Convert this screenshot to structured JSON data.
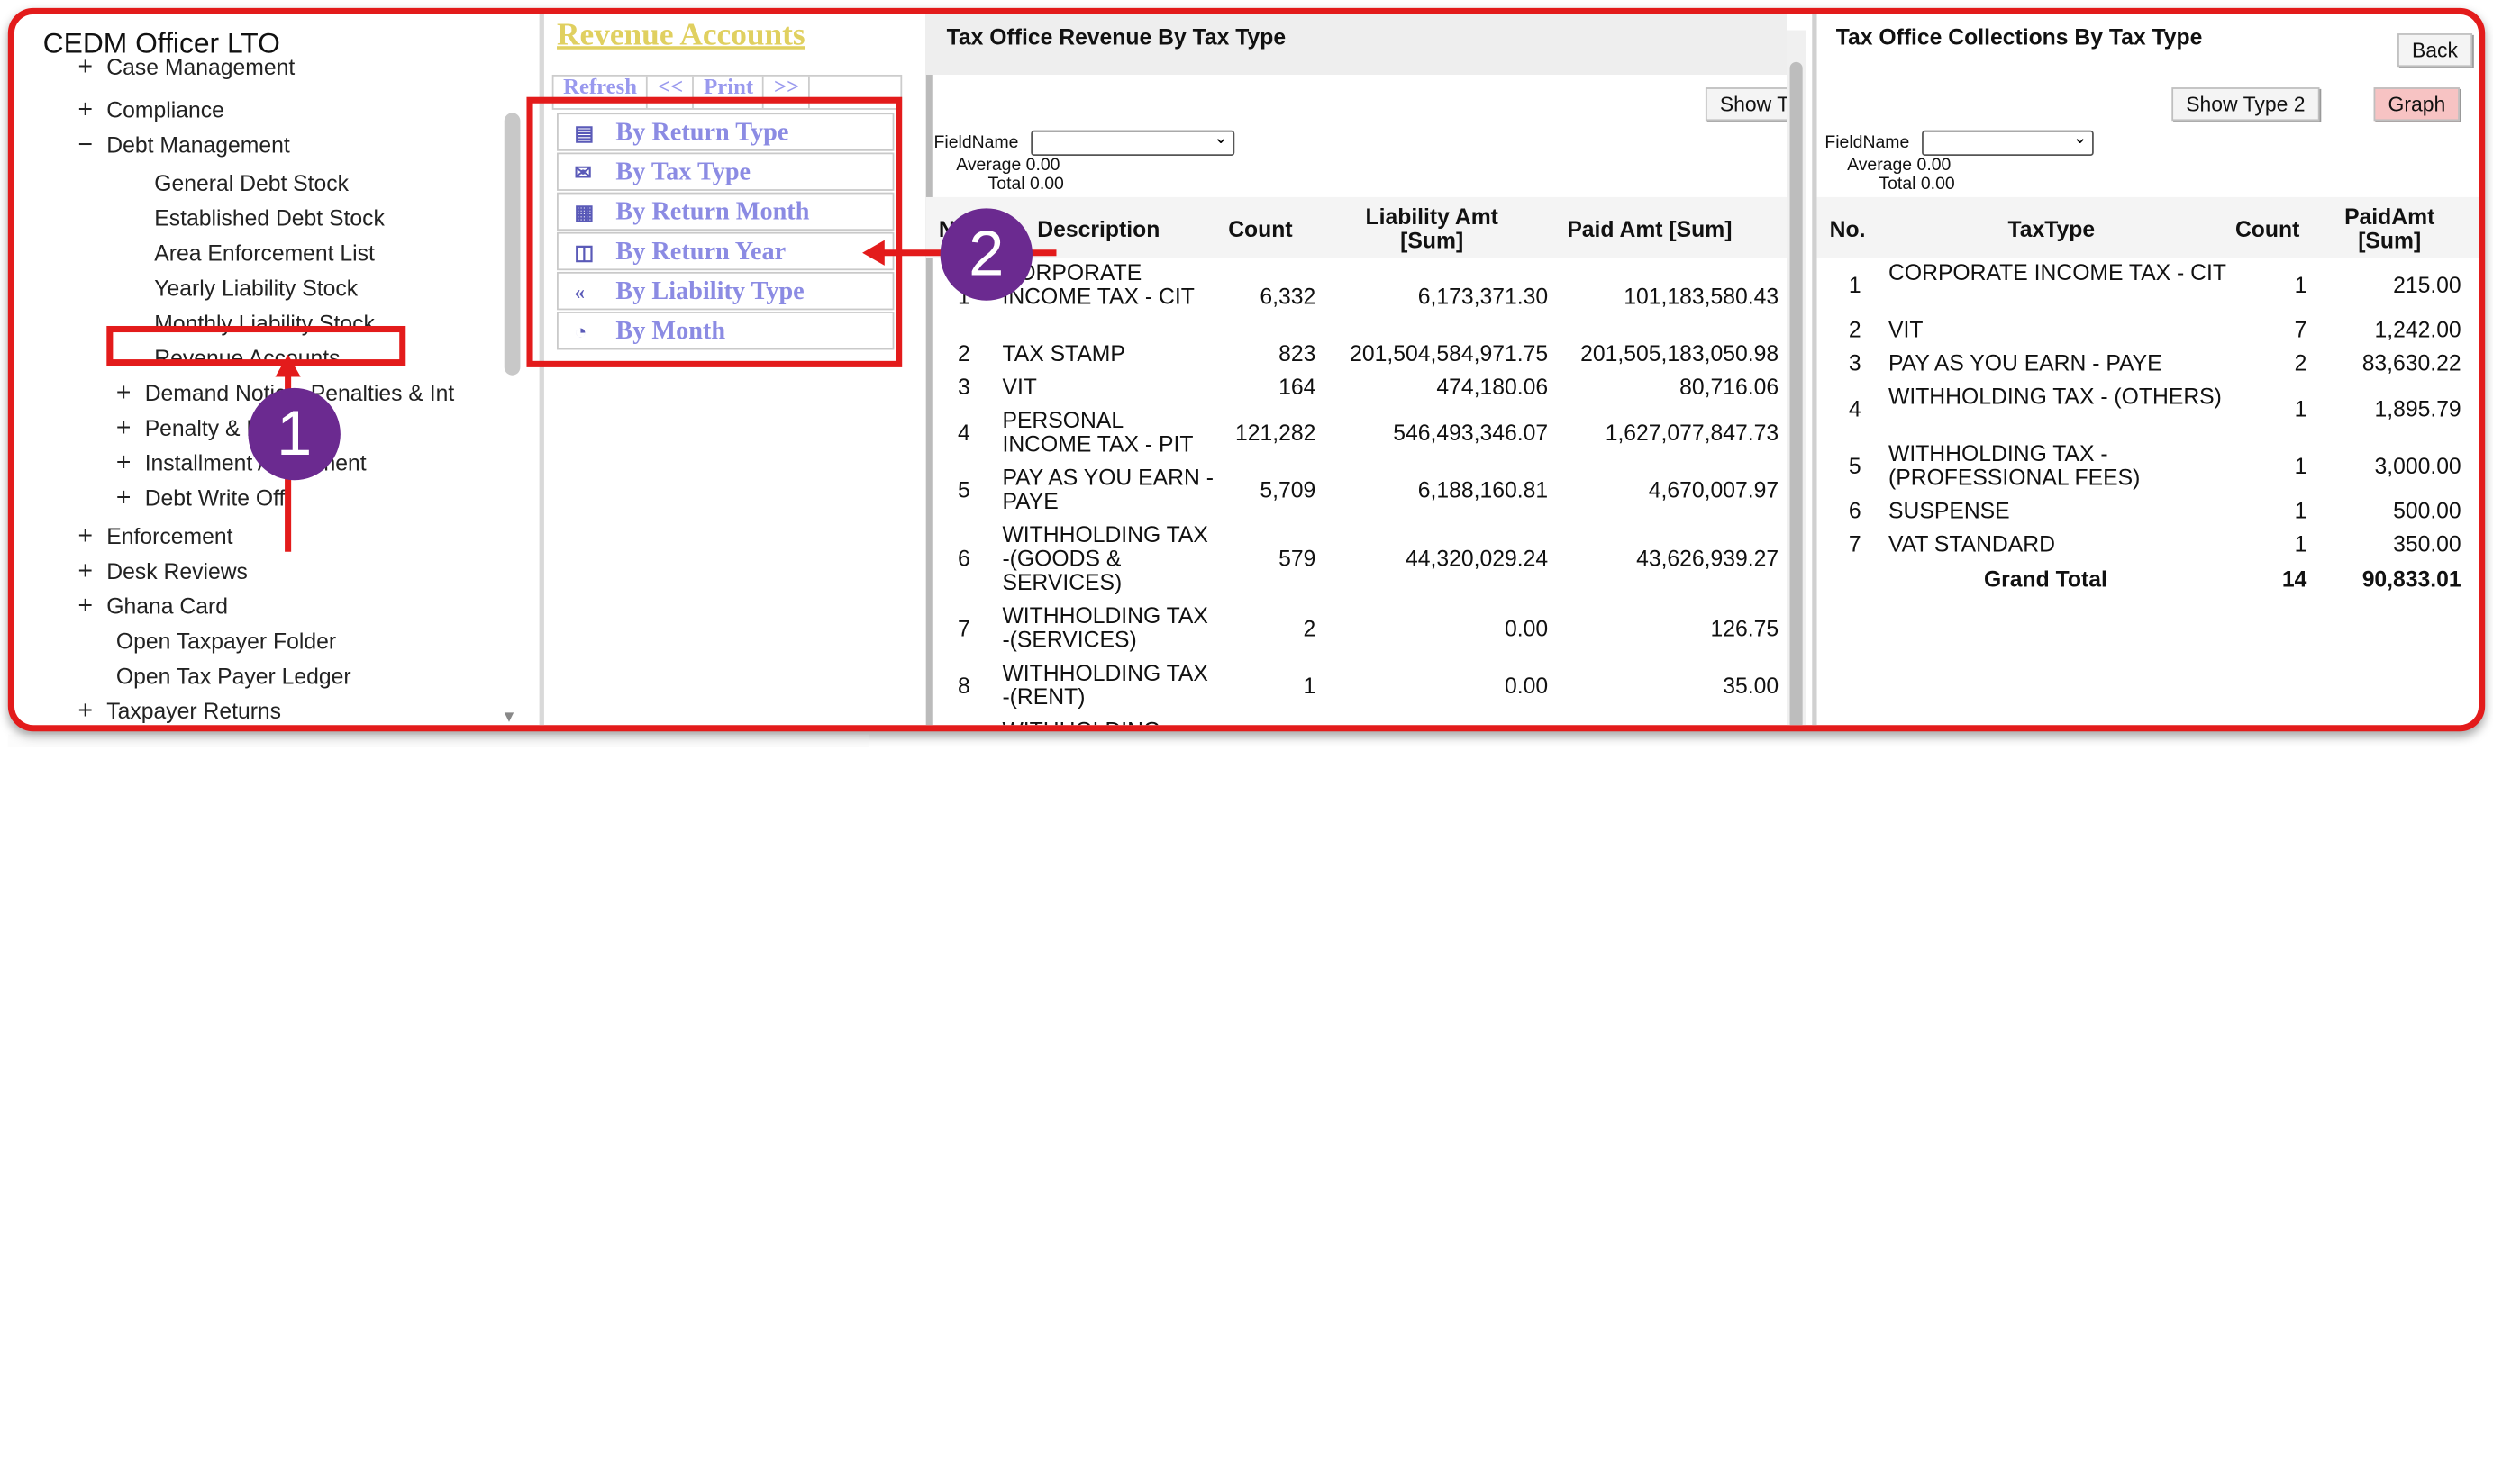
{
  "app": {
    "title": "CEDM Officer LTO"
  },
  "sidebar": {
    "items": [
      {
        "symbol": "+",
        "label": "Case Management"
      },
      {
        "symbol": "+",
        "label": "Compliance"
      },
      {
        "symbol": "−",
        "label": "Debt Management"
      },
      {
        "symbol": "",
        "label": "General Debt Stock"
      },
      {
        "symbol": "",
        "label": "Established Debt Stock"
      },
      {
        "symbol": "",
        "label": "Area Enforcement List"
      },
      {
        "symbol": "",
        "label": "Yearly Liability Stock"
      },
      {
        "symbol": "",
        "label": "Monthly Liability Stock"
      },
      {
        "symbol": "",
        "label": "Revenue Accounts"
      },
      {
        "symbol": "+",
        "label": "Demand Notice, Penalties & Int"
      },
      {
        "symbol": "+",
        "label": "Penalty & Demand"
      },
      {
        "symbol": "+",
        "label": "Installment Agreement"
      },
      {
        "symbol": "+",
        "label": "Debt Write Off"
      },
      {
        "symbol": "+",
        "label": "Enforcement"
      },
      {
        "symbol": "+",
        "label": "Desk Reviews"
      },
      {
        "symbol": "+",
        "label": "Ghana Card"
      },
      {
        "symbol": "",
        "label": "Open Taxpayer Folder"
      },
      {
        "symbol": "",
        "label": "Open Tax Payer Ledger"
      },
      {
        "symbol": "+",
        "label": "Taxpayer Returns"
      }
    ]
  },
  "revenue_accounts": {
    "title": "Revenue Accounts",
    "toolbar": [
      "Refresh",
      "<<",
      "Print",
      ">>"
    ],
    "menu": [
      {
        "label": "By Return Type",
        "icon": "report-icon"
      },
      {
        "label": "By Tax Type",
        "icon": "email-icon"
      },
      {
        "label": "By Return Month",
        "icon": "calendar-icon"
      },
      {
        "label": "By Return Year",
        "icon": "bin-icon"
      },
      {
        "label": "By Liability Type",
        "icon": "double-chevron-left-icon"
      },
      {
        "label": "By Month",
        "icon": "chart-icon"
      }
    ]
  },
  "revenue_panel": {
    "title": "Tax Office Revenue By Tax Type",
    "show_button": "Show T",
    "field_label": "FieldName",
    "average_label": "Average",
    "average_value": "0.00",
    "total_label": "Total",
    "total_value": "0.00",
    "columns": [
      "No.",
      "Description",
      "Count",
      "Liability Amt [Sum]",
      "Paid Amt [Sum]"
    ],
    "rows": [
      {
        "no": "1",
        "desc": "CORPORATE INCOME TAX - CIT",
        "count": "6,332",
        "liab": "6,173,371.30",
        "paid": "101,183,580.43"
      },
      {
        "no": "2",
        "desc": "TAX STAMP",
        "count": "823",
        "liab": "201,504,584,971.75",
        "paid": "201,505,183,050.98"
      },
      {
        "no": "3",
        "desc": "VIT",
        "count": "164",
        "liab": "474,180.06",
        "paid": "80,716.06"
      },
      {
        "no": "4",
        "desc": "PERSONAL INCOME TAX - PIT",
        "count": "121,282",
        "liab": "546,493,346.07",
        "paid": "1,627,077,847.73"
      },
      {
        "no": "5",
        "desc": "PAY AS YOU EARN - PAYE",
        "count": "5,709",
        "liab": "6,188,160.81",
        "paid": "4,670,007.97"
      },
      {
        "no": "6",
        "desc": "WITHHOLDING TAX -(GOODS & SERVICES)",
        "count": "579",
        "liab": "44,320,029.24",
        "paid": "43,626,939.27"
      },
      {
        "no": "7",
        "desc": "WITHHOLDING TAX -(SERVICES)",
        "count": "2",
        "liab": "0.00",
        "paid": "126.75"
      },
      {
        "no": "8",
        "desc": "WITHHOLDING TAX -(RENT)",
        "count": "1",
        "liab": "0.00",
        "paid": "35.00"
      },
      {
        "no": "",
        "desc": "WITHHOLDING",
        "count": "",
        "liab": "",
        "paid": ""
      }
    ]
  },
  "collections_panel": {
    "title": "Tax Office Collections By Tax Type",
    "back_button": "Back",
    "show_type_button": "Show Type 2",
    "graph_button": "Graph",
    "field_label": "FieldName",
    "average_label": "Average",
    "average_value": "0.00",
    "total_label": "Total",
    "total_value": "0.00",
    "columns": [
      "No.",
      "TaxType",
      "Count",
      "PaidAmt [Sum]"
    ],
    "rows": [
      {
        "no": "1",
        "type": "CORPORATE INCOME TAX - CIT",
        "count": "1",
        "paid": "215.00"
      },
      {
        "no": "2",
        "type": "VIT",
        "count": "7",
        "paid": "1,242.00"
      },
      {
        "no": "3",
        "type": "PAY AS YOU EARN - PAYE",
        "count": "2",
        "paid": "83,630.22"
      },
      {
        "no": "4",
        "type": "WITHHOLDING TAX - (OTHERS)",
        "count": "1",
        "paid": "1,895.79"
      },
      {
        "no": "5",
        "type": "WITHHOLDING TAX - (PROFESSIONAL FEES)",
        "count": "1",
        "paid": "3,000.00"
      },
      {
        "no": "6",
        "type": "SUSPENSE",
        "count": "1",
        "paid": "500.00"
      },
      {
        "no": "7",
        "type": "VAT STANDARD",
        "count": "1",
        "paid": "350.00"
      }
    ],
    "grand_total_label": "Grand Total",
    "grand_total_count": "14",
    "grand_total_paid": "90,833.01"
  },
  "annotations": {
    "step1": "1",
    "step2": "2"
  },
  "colors": {
    "highlight": "#e31b1b",
    "badge": "#6b2a90",
    "menu_text": "#8b8be3",
    "title_gold": "#e0d060"
  }
}
